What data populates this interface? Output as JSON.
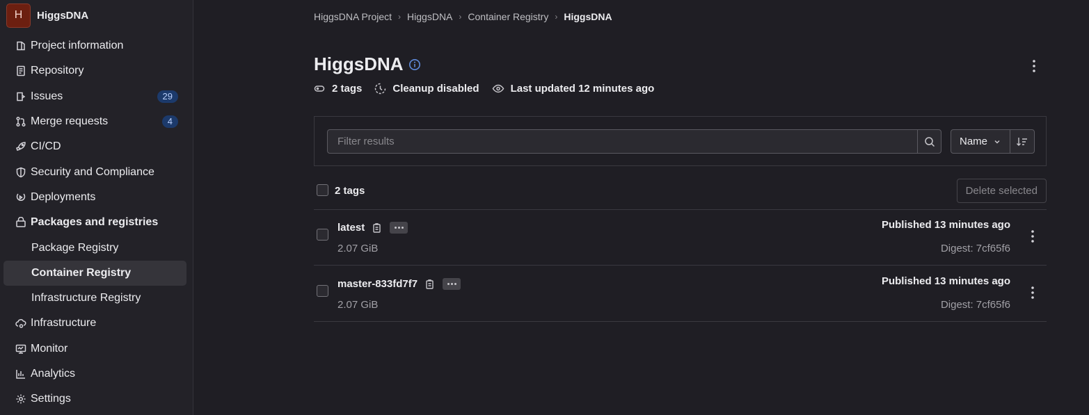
{
  "project": {
    "avatar_letter": "H",
    "name": "HiggsDNA"
  },
  "sidebar": {
    "items": [
      {
        "label": "Project information",
        "icon": "project-icon"
      },
      {
        "label": "Repository",
        "icon": "doc-icon"
      },
      {
        "label": "Issues",
        "icon": "issues-icon",
        "badge": "29"
      },
      {
        "label": "Merge requests",
        "icon": "merge-icon",
        "badge": "4"
      },
      {
        "label": "CI/CD",
        "icon": "rocket-icon"
      },
      {
        "label": "Security and Compliance",
        "icon": "shield-icon"
      },
      {
        "label": "Deployments",
        "icon": "deployments-icon"
      },
      {
        "label": "Packages and registries",
        "icon": "package-icon"
      },
      {
        "label": "Package Registry"
      },
      {
        "label": "Container Registry"
      },
      {
        "label": "Infrastructure Registry"
      },
      {
        "label": "Infrastructure",
        "icon": "cloud-gear-icon"
      },
      {
        "label": "Monitor",
        "icon": "monitor-icon"
      },
      {
        "label": "Analytics",
        "icon": "chart-icon"
      },
      {
        "label": "Settings",
        "icon": "gear-icon"
      }
    ]
  },
  "breadcrumb": [
    "HiggsDNA Project",
    "HiggsDNA",
    "Container Registry",
    "HiggsDNA"
  ],
  "header": {
    "title": "HiggsDNA",
    "tags_count": "2 tags",
    "cleanup": "Cleanup disabled",
    "last_updated": "Last updated 12 minutes ago"
  },
  "filter": {
    "placeholder": "Filter results",
    "sort_label": "Name"
  },
  "list": {
    "count_label": "2 tags",
    "delete_label": "Delete selected",
    "tags": [
      {
        "name": "latest",
        "size": "2.07 GiB",
        "published": "Published 13 minutes ago",
        "digest": "Digest: 7cf65f6"
      },
      {
        "name": "master-833fd7f7",
        "size": "2.07 GiB",
        "published": "Published 13 minutes ago",
        "digest": "Digest: 7cf65f6"
      }
    ]
  },
  "colors": {
    "badge_bg": "#1c3a6b",
    "avatar_bg": "#6c1f10",
    "info_icon": "#5f8bdb"
  }
}
